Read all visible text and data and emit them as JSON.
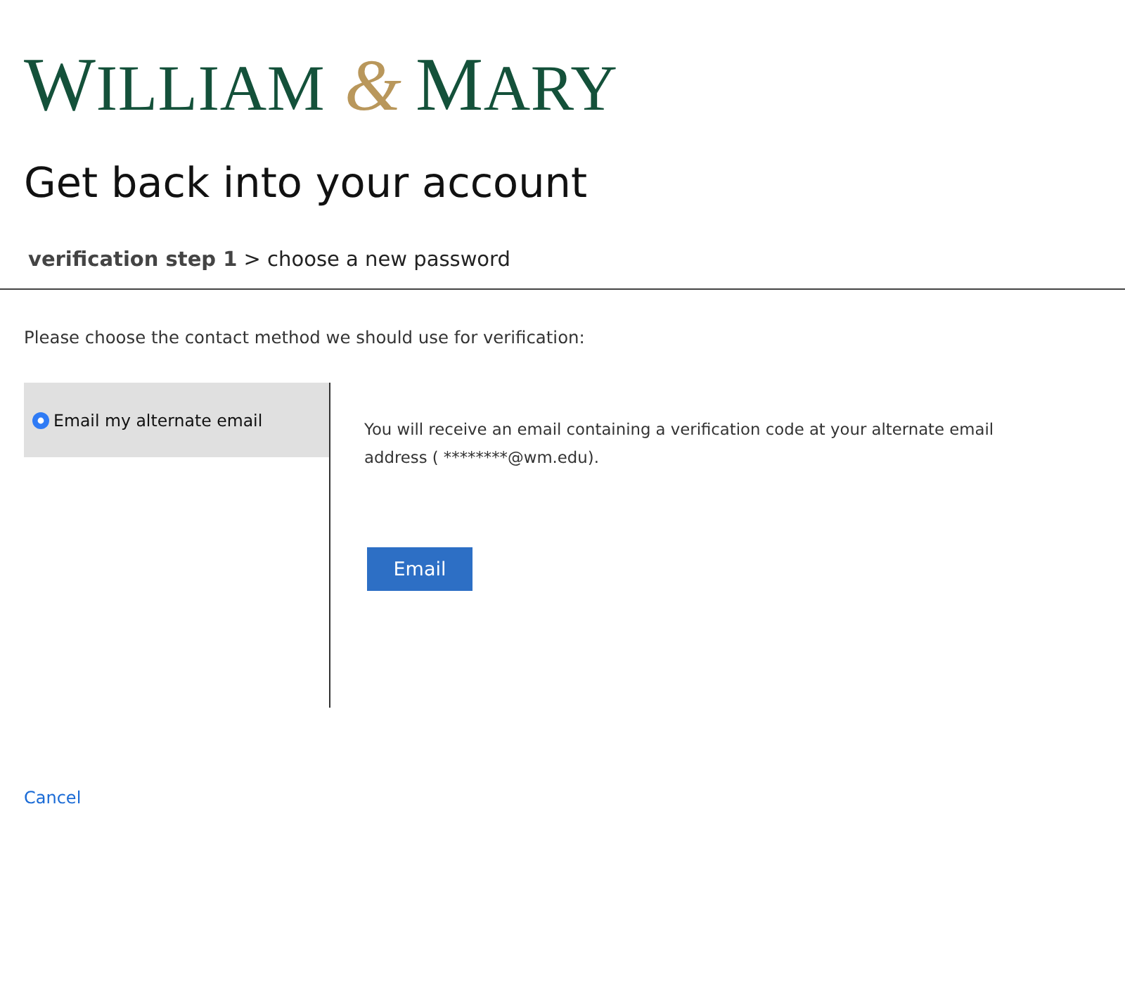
{
  "logo": {
    "parts": [
      {
        "text": "WILLIAM",
        "kind": "word"
      },
      {
        "text": "&",
        "kind": "ampersand"
      },
      {
        "text": "MARY",
        "kind": "word"
      }
    ]
  },
  "heading": "Get back into your account",
  "breadcrumb": "**verification step 1** > choose a new password",
  "instruction": "Please choose the contact method we should use for verification:",
  "methods": [
    {
      "label": "Email my alternate email",
      "selected": true
    }
  ],
  "detail": {
    "description": "You will receive an email containing a verification code at your alternate email address ( ********@wm.edu).",
    "button": "Email"
  },
  "cancel": "Cancel"
}
